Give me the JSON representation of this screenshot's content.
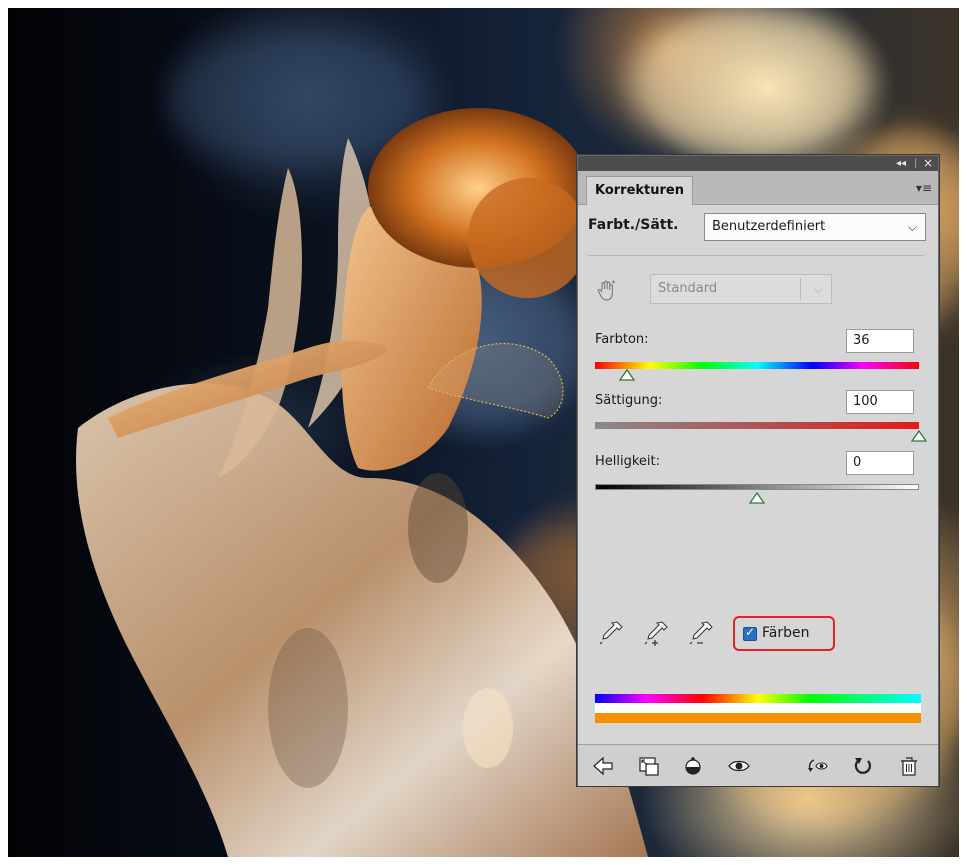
{
  "panel": {
    "tab_label": "Korrekturen",
    "adjustment_label": "Farbt./Sätt.",
    "preset_value": "Benutzerdefiniert",
    "channel_value": "Standard",
    "sliders": [
      {
        "label": "Farbton:",
        "value": "36",
        "fraction": 0.1
      },
      {
        "label": "Sättigung:",
        "value": "100",
        "fraction": 1.0
      },
      {
        "label": "Helligkeit:",
        "value": "0",
        "fraction": 0.5
      }
    ],
    "colorize": {
      "label": "Färben",
      "checked": true
    },
    "highlight_color": "#e0242a",
    "checkbox_color": "#2b6fbf",
    "result_color": "#f59000"
  },
  "icons": {
    "collapse": "◂◂",
    "close": "×",
    "menu": "▾≡",
    "chevron": "⌵",
    "check": "✓"
  }
}
